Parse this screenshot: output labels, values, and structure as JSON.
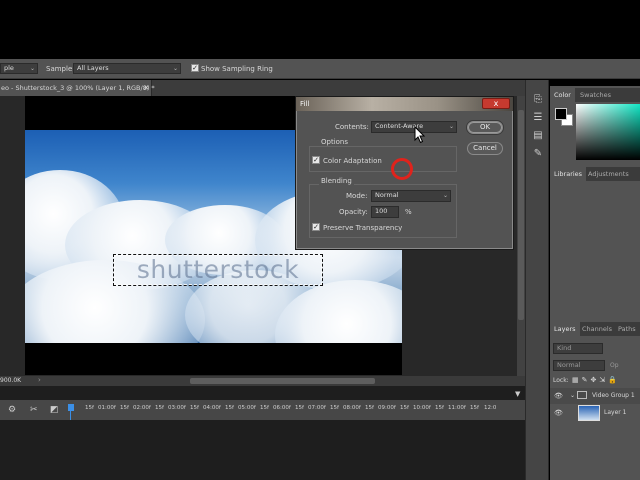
{
  "options_bar": {
    "left_mode_value": "ple",
    "sample_label": "Sample:",
    "sample_value": "All Layers",
    "show_sampling_ring_label": "Show Sampling Ring"
  },
  "document_tab": {
    "title": "eo - Shutterstock_3 @ 100% (Layer 1, RGB/8) *",
    "close_glyph": "×"
  },
  "canvas": {
    "watermark_text": "shutterstock"
  },
  "status": {
    "doc_size": "900.0K"
  },
  "fill_dialog": {
    "title": "Fill",
    "close_glyph": "x",
    "contents_label": "Contents:",
    "contents_value": "Content-Aware",
    "options_label": "Options",
    "color_adaptation_label": "Color Adaptation",
    "color_adaptation_checked": true,
    "blending_label": "Blending",
    "mode_label": "Mode:",
    "mode_value": "Normal",
    "opacity_label": "Opacity:",
    "opacity_value": "100",
    "opacity_unit": "%",
    "preserve_transparency_label": "Preserve Transparency",
    "preserve_transparency_checked": true,
    "ok_label": "OK",
    "cancel_label": "Cancel"
  },
  "right_panels": {
    "color_tabs": [
      "Color",
      "Swatches"
    ],
    "library_tabs": [
      "Libraries",
      "Adjustments"
    ],
    "layers_tabs": [
      "Layers",
      "Channels",
      "Paths"
    ],
    "kind_placeholder": "Kind",
    "blend_mode_value": "Normal",
    "opacity_label": "Op",
    "lock_label": "Lock:",
    "layers": [
      {
        "name": "Video Group 1"
      },
      {
        "name": "Layer 1"
      }
    ]
  },
  "timeline": {
    "ticks": [
      "15f",
      "01:00f",
      "15f",
      "02:00f",
      "15f",
      "03:00f",
      "15f",
      "04:00f",
      "15f",
      "05:00f",
      "15f",
      "06:00f",
      "15f",
      "07:00f",
      "15f",
      "08:00f",
      "15f",
      "09:00f",
      "15f",
      "10:00f",
      "15f",
      "11:00f",
      "15f",
      "12:0"
    ]
  },
  "colors": {
    "accent_red": "#e0231c",
    "panel_bg": "#535353"
  }
}
